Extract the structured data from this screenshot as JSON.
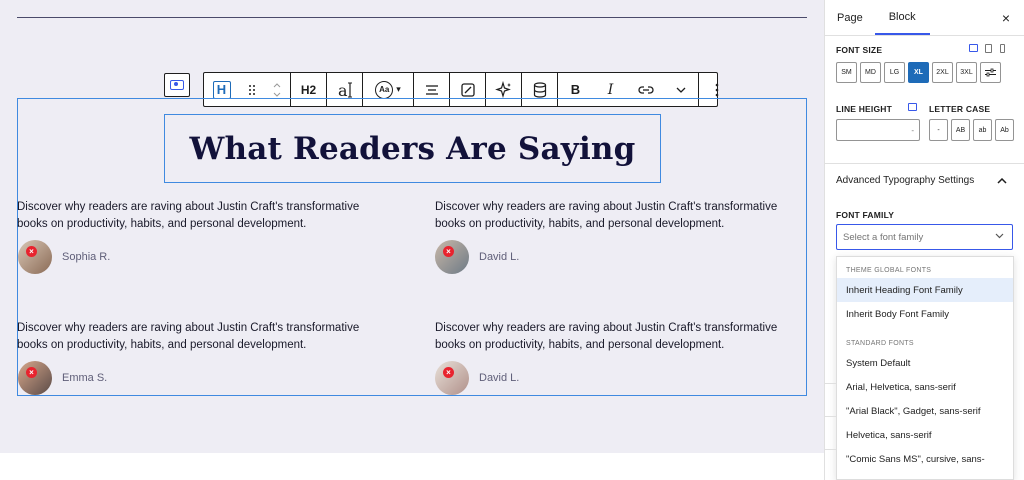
{
  "toolbar": {
    "heading_level": "H2",
    "font_size_icon": "Aa",
    "items": [
      "heading-block-icon",
      "drag-handle-icon",
      "move-up-down-icon",
      "heading-level",
      "font-icon",
      "typography-icon",
      "align-icon",
      "crop-icon",
      "ai-sparkle-icon",
      "database-icon",
      "bold-icon",
      "italic-icon",
      "link-icon",
      "more-chevron-icon",
      "options-icon"
    ]
  },
  "canvas": {
    "heading": "What Readers Are Saying",
    "testimonials": [
      {
        "quote": "Discover why readers are raving about Justin Craft's transformative books on productivity, habits, and personal development.",
        "name": "Sophia R."
      },
      {
        "quote": "Discover why readers are raving about Justin Craft's transformative books on productivity, habits, and personal development.",
        "name": "David L."
      },
      {
        "quote": "Discover why readers are raving about Justin Craft's transformative books on productivity, habits, and personal development.",
        "name": "Emma S."
      },
      {
        "quote": "Discover why readers are raving about Justin Craft's transformative books on productivity, habits, and personal development.",
        "name": "David L."
      }
    ]
  },
  "sidebar": {
    "tabs": [
      "Page",
      "Block"
    ],
    "active_tab": "Block",
    "close_icon": "×",
    "font_size": {
      "label": "FONT SIZE",
      "options": [
        "SM",
        "MD",
        "LG",
        "XL",
        "2XL",
        "3XL"
      ],
      "selected": "XL"
    },
    "line_height": {
      "label": "LINE HEIGHT",
      "value": "-"
    },
    "letter_case": {
      "label": "LETTER CASE",
      "options": [
        "-",
        "AB",
        "ab",
        "Ab"
      ]
    },
    "advanced": {
      "title": "Advanced Typography Settings",
      "font_family_label": "FONT FAMILY",
      "placeholder": "Select a font family",
      "groups": [
        {
          "label": "THEME GLOBAL FONTS",
          "items": [
            "Inherit Heading Font Family",
            "Inherit Body Font Family"
          ]
        },
        {
          "label": "STANDARD FONTS",
          "items": [
            "System Default",
            "Arial, Helvetica, sans-serif",
            "\"Arial Black\", Gadget, sans-serif",
            "Helvetica, sans-serif",
            "\"Comic Sans MS\", cursive, sans-"
          ]
        }
      ],
      "highlighted": "Inherit Heading Font Family"
    }
  },
  "colors": {
    "accent": "#3858e9",
    "selection": "#3f8ae0",
    "canvas_bg": "#eeedf4",
    "heading": "#12123a"
  }
}
